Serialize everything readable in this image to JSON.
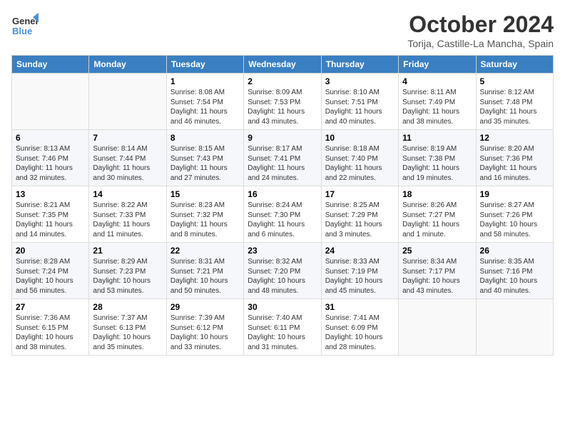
{
  "header": {
    "logo_general": "General",
    "logo_blue": "Blue",
    "month": "October 2024",
    "location": "Torija, Castille-La Mancha, Spain"
  },
  "days_of_week": [
    "Sunday",
    "Monday",
    "Tuesday",
    "Wednesday",
    "Thursday",
    "Friday",
    "Saturday"
  ],
  "weeks": [
    [
      {
        "date": "",
        "text": ""
      },
      {
        "date": "",
        "text": ""
      },
      {
        "date": "1",
        "text": "Sunrise: 8:08 AM\nSunset: 7:54 PM\nDaylight: 11 hours and 46 minutes."
      },
      {
        "date": "2",
        "text": "Sunrise: 8:09 AM\nSunset: 7:53 PM\nDaylight: 11 hours and 43 minutes."
      },
      {
        "date": "3",
        "text": "Sunrise: 8:10 AM\nSunset: 7:51 PM\nDaylight: 11 hours and 40 minutes."
      },
      {
        "date": "4",
        "text": "Sunrise: 8:11 AM\nSunset: 7:49 PM\nDaylight: 11 hours and 38 minutes."
      },
      {
        "date": "5",
        "text": "Sunrise: 8:12 AM\nSunset: 7:48 PM\nDaylight: 11 hours and 35 minutes."
      }
    ],
    [
      {
        "date": "6",
        "text": "Sunrise: 8:13 AM\nSunset: 7:46 PM\nDaylight: 11 hours and 32 minutes."
      },
      {
        "date": "7",
        "text": "Sunrise: 8:14 AM\nSunset: 7:44 PM\nDaylight: 11 hours and 30 minutes."
      },
      {
        "date": "8",
        "text": "Sunrise: 8:15 AM\nSunset: 7:43 PM\nDaylight: 11 hours and 27 minutes."
      },
      {
        "date": "9",
        "text": "Sunrise: 8:17 AM\nSunset: 7:41 PM\nDaylight: 11 hours and 24 minutes."
      },
      {
        "date": "10",
        "text": "Sunrise: 8:18 AM\nSunset: 7:40 PM\nDaylight: 11 hours and 22 minutes."
      },
      {
        "date": "11",
        "text": "Sunrise: 8:19 AM\nSunset: 7:38 PM\nDaylight: 11 hours and 19 minutes."
      },
      {
        "date": "12",
        "text": "Sunrise: 8:20 AM\nSunset: 7:36 PM\nDaylight: 11 hours and 16 minutes."
      }
    ],
    [
      {
        "date": "13",
        "text": "Sunrise: 8:21 AM\nSunset: 7:35 PM\nDaylight: 11 hours and 14 minutes."
      },
      {
        "date": "14",
        "text": "Sunrise: 8:22 AM\nSunset: 7:33 PM\nDaylight: 11 hours and 11 minutes."
      },
      {
        "date": "15",
        "text": "Sunrise: 8:23 AM\nSunset: 7:32 PM\nDaylight: 11 hours and 8 minutes."
      },
      {
        "date": "16",
        "text": "Sunrise: 8:24 AM\nSunset: 7:30 PM\nDaylight: 11 hours and 6 minutes."
      },
      {
        "date": "17",
        "text": "Sunrise: 8:25 AM\nSunset: 7:29 PM\nDaylight: 11 hours and 3 minutes."
      },
      {
        "date": "18",
        "text": "Sunrise: 8:26 AM\nSunset: 7:27 PM\nDaylight: 11 hours and 1 minute."
      },
      {
        "date": "19",
        "text": "Sunrise: 8:27 AM\nSunset: 7:26 PM\nDaylight: 10 hours and 58 minutes."
      }
    ],
    [
      {
        "date": "20",
        "text": "Sunrise: 8:28 AM\nSunset: 7:24 PM\nDaylight: 10 hours and 56 minutes."
      },
      {
        "date": "21",
        "text": "Sunrise: 8:29 AM\nSunset: 7:23 PM\nDaylight: 10 hours and 53 minutes."
      },
      {
        "date": "22",
        "text": "Sunrise: 8:31 AM\nSunset: 7:21 PM\nDaylight: 10 hours and 50 minutes."
      },
      {
        "date": "23",
        "text": "Sunrise: 8:32 AM\nSunset: 7:20 PM\nDaylight: 10 hours and 48 minutes."
      },
      {
        "date": "24",
        "text": "Sunrise: 8:33 AM\nSunset: 7:19 PM\nDaylight: 10 hours and 45 minutes."
      },
      {
        "date": "25",
        "text": "Sunrise: 8:34 AM\nSunset: 7:17 PM\nDaylight: 10 hours and 43 minutes."
      },
      {
        "date": "26",
        "text": "Sunrise: 8:35 AM\nSunset: 7:16 PM\nDaylight: 10 hours and 40 minutes."
      }
    ],
    [
      {
        "date": "27",
        "text": "Sunrise: 7:36 AM\nSunset: 6:15 PM\nDaylight: 10 hours and 38 minutes."
      },
      {
        "date": "28",
        "text": "Sunrise: 7:37 AM\nSunset: 6:13 PM\nDaylight: 10 hours and 35 minutes."
      },
      {
        "date": "29",
        "text": "Sunrise: 7:39 AM\nSunset: 6:12 PM\nDaylight: 10 hours and 33 minutes."
      },
      {
        "date": "30",
        "text": "Sunrise: 7:40 AM\nSunset: 6:11 PM\nDaylight: 10 hours and 31 minutes."
      },
      {
        "date": "31",
        "text": "Sunrise: 7:41 AM\nSunset: 6:09 PM\nDaylight: 10 hours and 28 minutes."
      },
      {
        "date": "",
        "text": ""
      },
      {
        "date": "",
        "text": ""
      }
    ]
  ]
}
